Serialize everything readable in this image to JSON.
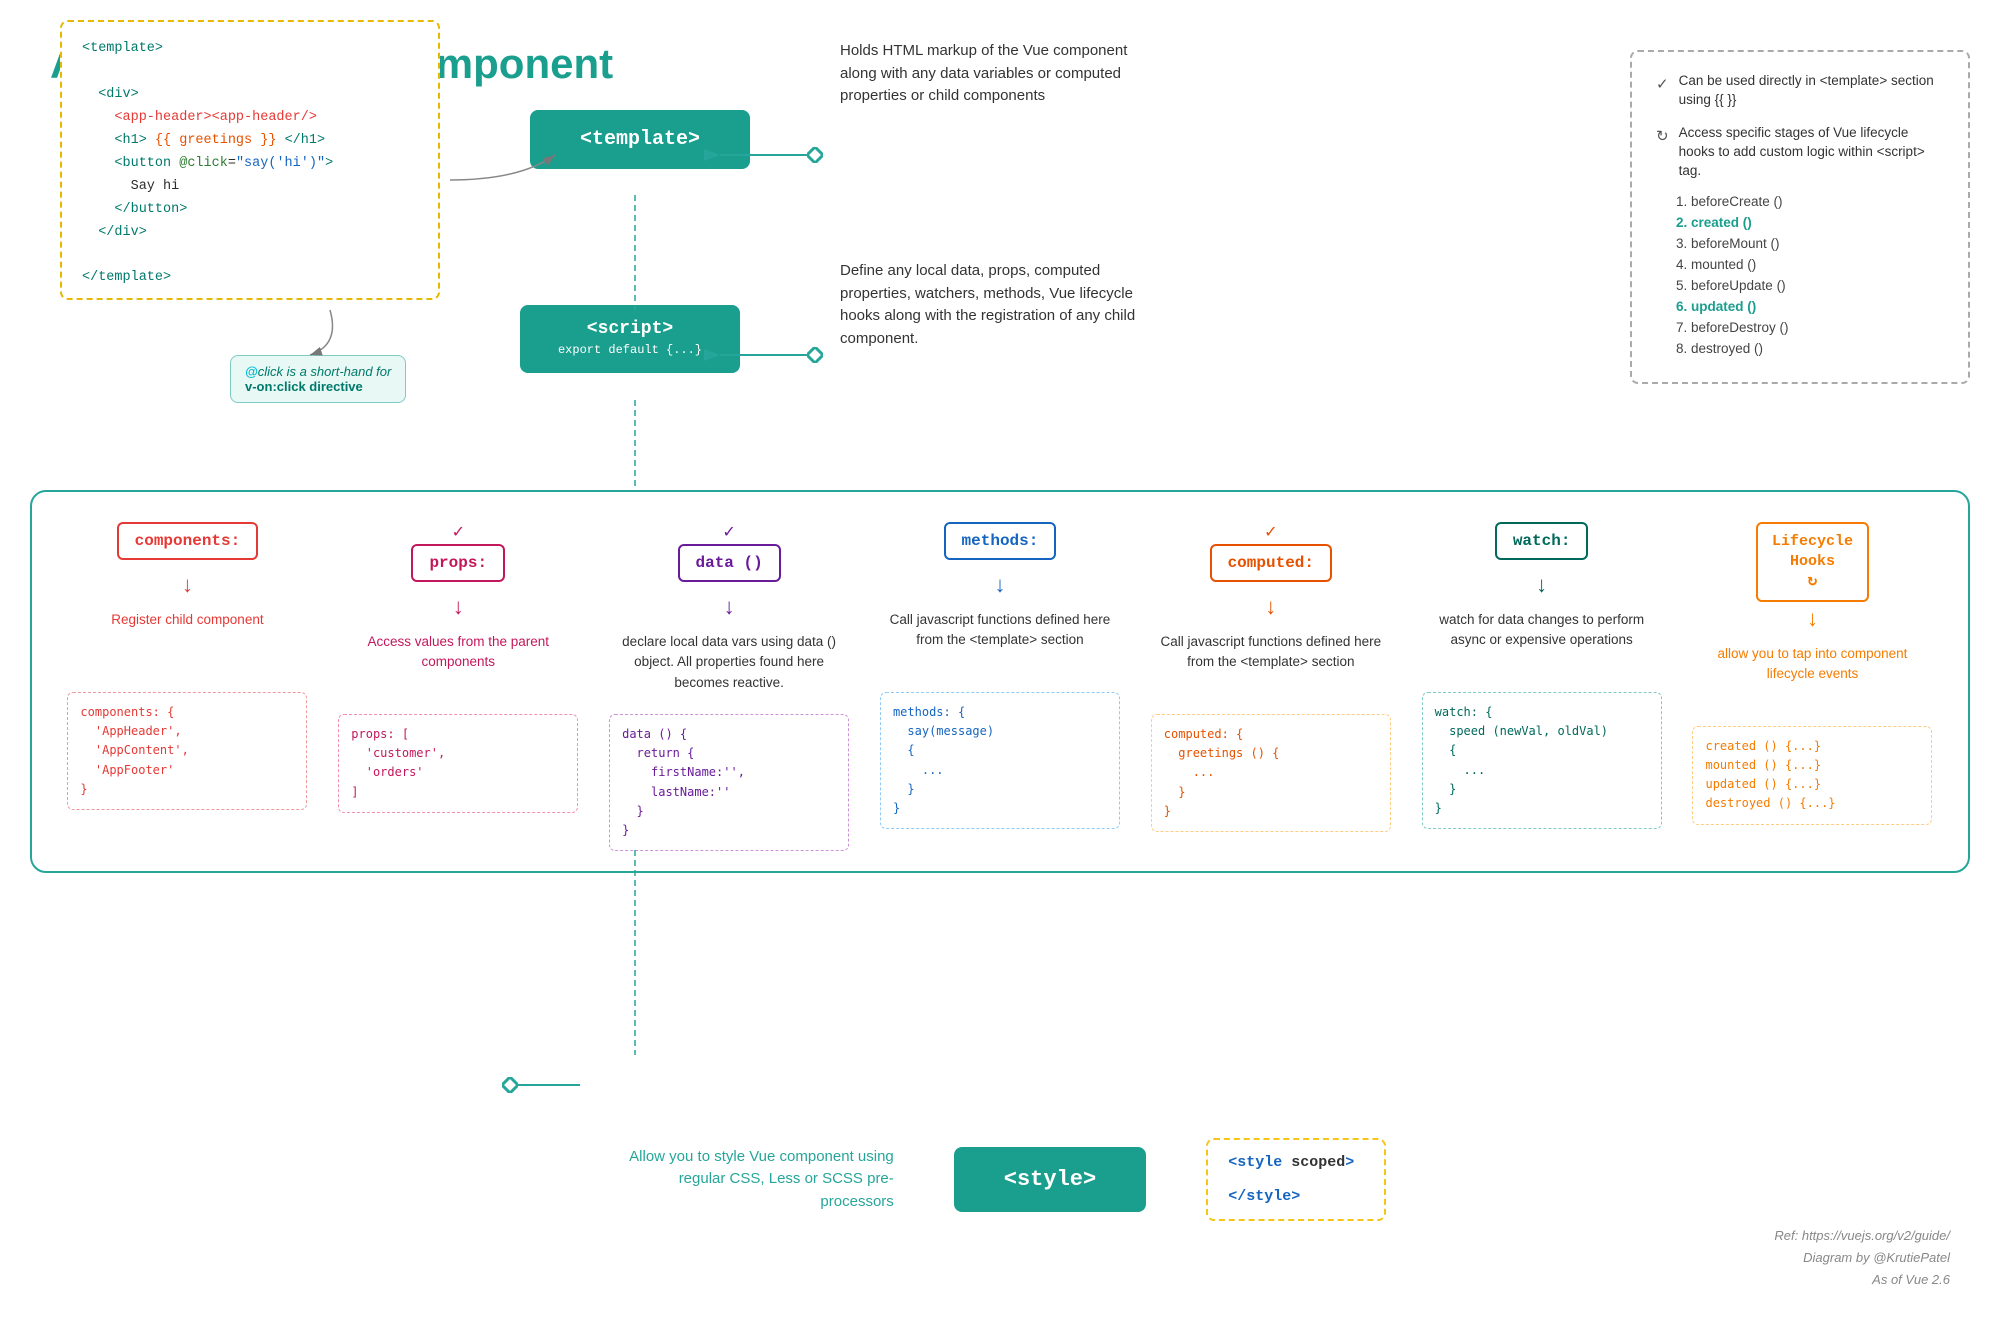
{
  "title": "Anatomy of Vue Component",
  "topSection": {
    "templateBlock": "<template>",
    "scriptBlock": "<script>\nexport default {...}",
    "styleBlock": "<style>",
    "templateDesc": "Holds HTML markup of the Vue component  along with any data variables or computed properties or child components",
    "scriptDesc": "Define any local data, props, computed properties, watchers, methods, Vue lifecycle hooks along with the registration of any child component.",
    "styleDesc": "Allow you to style Vue component using regular CSS, Less or SCSS pre-processors"
  },
  "codeBox": {
    "lines": [
      "<template>",
      "  <div>",
      "    <app-header><app-header/>",
      "    <h1> {{ greetings }} </h1>",
      "    <button @click=\"say('hi')\">",
      "      Say hi",
      "    </button>",
      "  </div>",
      "</template>"
    ]
  },
  "clickAnnotation": {
    "text1": "@click is a short-hand for",
    "text2": "v-on:click directive"
  },
  "lifecycleBox": {
    "item1": "Can be used directly in <template> section using {{ }}",
    "item2": "Access specific stages of Vue lifecycle hooks to add custom logic within <script> tag.",
    "hooks": [
      "1. beforeCreate ()",
      "2. created ()",
      "3. beforeMount ()",
      "4. mounted ()",
      "5. beforeUpdate ()",
      "6. updated ()",
      "7. beforeDestroy ()",
      "8. destroyed ()"
    ]
  },
  "columns": [
    {
      "id": "components",
      "label": "components:",
      "colorClass": "red",
      "hasCheck": false,
      "description": "Register child component",
      "descColor": "red",
      "code": "components: {\n  'AppHeader',\n  'AppContent',\n  'AppFooter'\n}"
    },
    {
      "id": "props",
      "label": "props:",
      "colorClass": "pink",
      "hasCheck": true,
      "description": "Access values from the parent components",
      "descColor": "pink",
      "code": "props: [\n  'customer',\n  'orders'\n]"
    },
    {
      "id": "data",
      "label": "data ()",
      "colorClass": "purple",
      "hasCheck": true,
      "description": "declare local data vars using data () object. All properties found here becomes reactive.",
      "descColor": "default",
      "code": "data () {\n  return {\n    firstName:'',\n    lastName:''\n  }\n}"
    },
    {
      "id": "methods",
      "label": "methods:",
      "colorClass": "blue",
      "hasCheck": false,
      "description": "Call javascript functions defined here from the <template> section",
      "descColor": "default",
      "code": "methods: {\n  say(message)\n  {\n    ...\n  }\n}"
    },
    {
      "id": "computed",
      "label": "computed:",
      "colorClass": "orange",
      "hasCheck": true,
      "description": "Call javascript functions defined here from the <template> section",
      "descColor": "default",
      "code": "computed: {\n  greetings () {\n    ...\n  }\n}"
    },
    {
      "id": "watch",
      "label": "watch:",
      "colorClass": "teal",
      "hasCheck": false,
      "description": "watch for data changes to perform async or expensive operations",
      "descColor": "default",
      "code": "watch: {\n  speed (newVal, oldVal)\n  {\n    ...\n  }\n}"
    },
    {
      "id": "lifecycle",
      "label": "Lifecycle\nHooks",
      "colorClass": "orange2",
      "hasCheck": false,
      "hasRefresh": true,
      "description": "allow you to tap into component lifecycle events",
      "descColor": "orange2",
      "code": "created () {...}\nmounted () {...}\nupdated () {...}\ndestroyed () {...}"
    }
  ],
  "styleSection": {
    "desc": "Allow you to style Vue component using regular CSS, Less or SCSS pre-processors",
    "blockLabel": "<style>",
    "scopedCode": "<style scoped>\n\n</style>"
  },
  "ref": {
    "line1": "Ref: https://vuejs.org/v2/guide/",
    "line2": "Diagram by @KrutiePatel",
    "line3": "As of Vue 2.6"
  }
}
